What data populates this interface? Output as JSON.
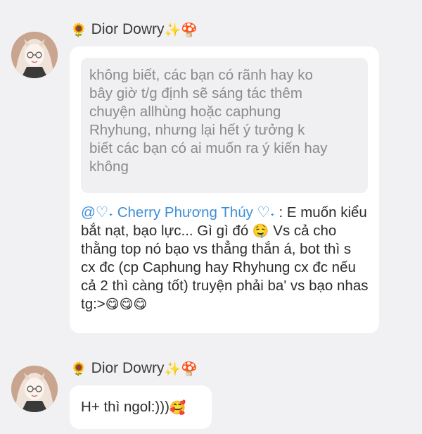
{
  "messages": [
    {
      "sender": {
        "prefix_icon": "🌻",
        "name": "Dior Dowry",
        "suffix_icons": "✨🍄"
      },
      "quote": "không biết, các bạn có rãnh hay ko\nbây giờ t/g định sẽ sáng tác thêm\nchuyện allhùng hoặc caphung\nRhyhung, nhưng lại hết ý tưởng k\nbiết các bạn có ai muốn ra ý kiến hay\nkhông",
      "mention": "@♡˖ Cherry Phương Thúy ♡˖",
      "text_before_emoji": " : E muốn kiểu bắt nạt, bạo lực... Gì gì đó ",
      "emoji_1": "🤤",
      "text_after_emoji": " Vs cả cho thằng top nó bạo vs thẳng thắn á, bot thì s cx đc (cp Caphung hay Rhyhung cx đc nếu cả 2 thì càng tốt) truyện phải ba' vs bạo nhas tg:>",
      "emoji_end": "😋😋😋"
    },
    {
      "sender": {
        "prefix_icon": "🌻",
        "name": "Dior Dowry",
        "suffix_icons": "✨🍄"
      },
      "text": "H+ thì ngol:)))",
      "emoji_end": "🥰"
    }
  ],
  "colors": {
    "background": "#f1f1f3",
    "bubble": "#ffffff",
    "quote_bg": "#f0f0f2",
    "mention": "#3d8fd6"
  }
}
